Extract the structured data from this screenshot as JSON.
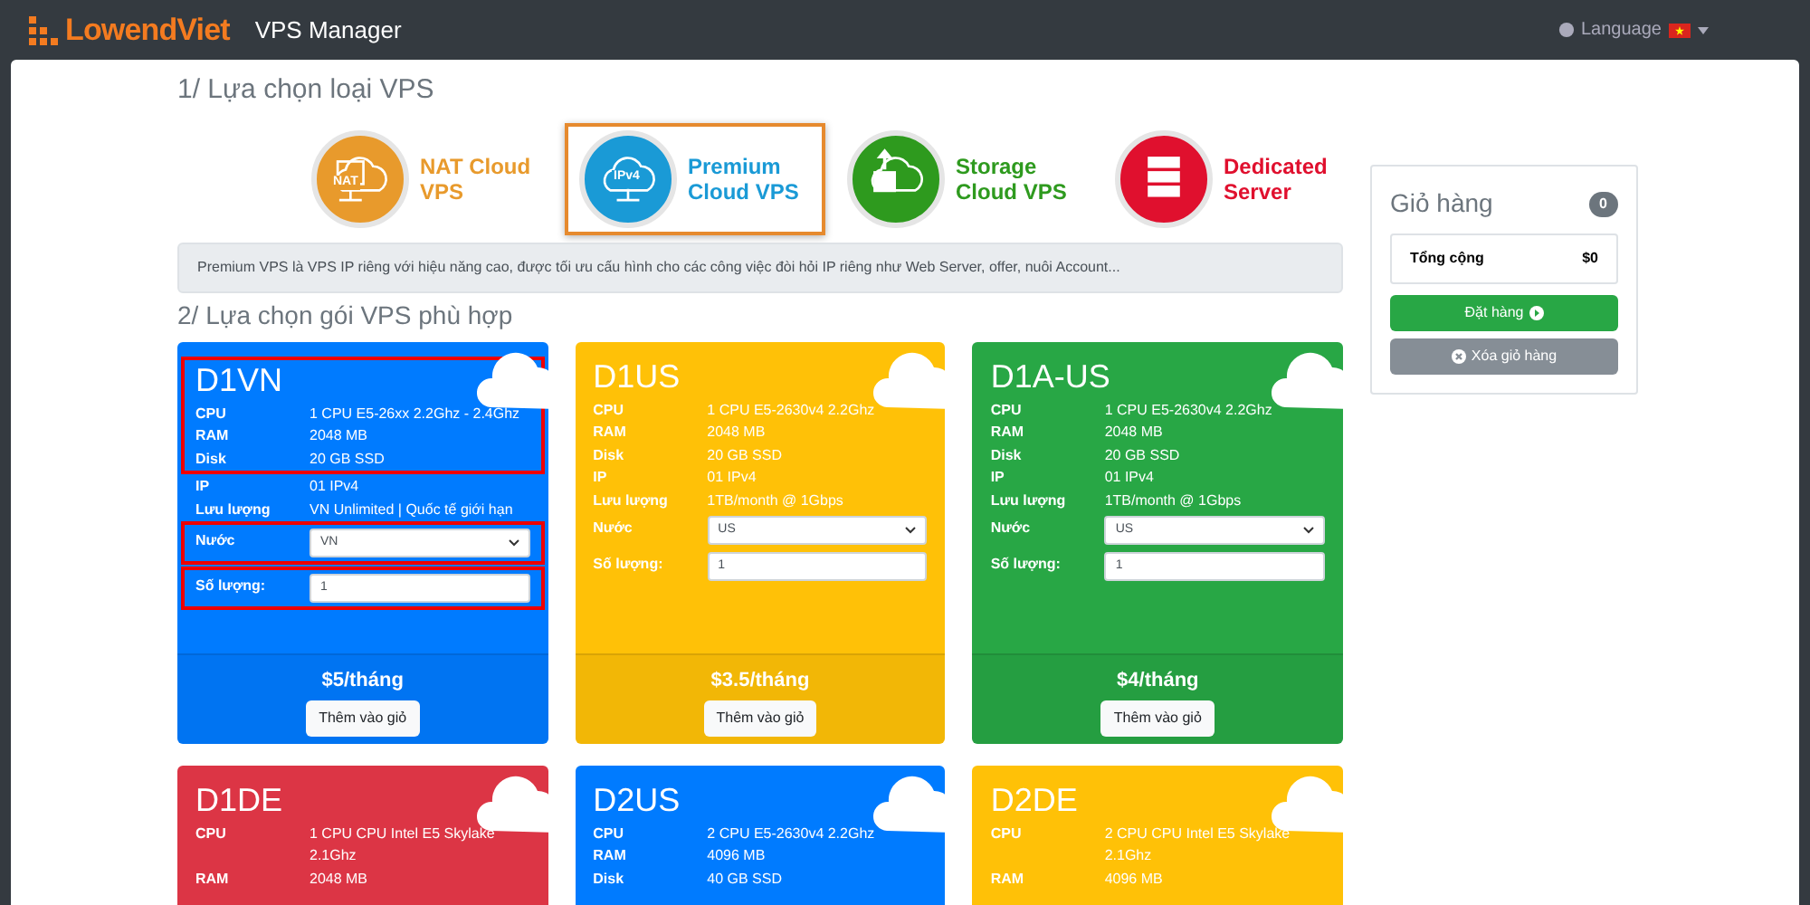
{
  "navbar": {
    "brand": "LowendViet",
    "title": "VPS Manager",
    "language": "Language"
  },
  "step1": {
    "heading": "1/ Lựa chọn loại VPS",
    "types": [
      {
        "kind": "nat",
        "label": "NAT Cloud VPS",
        "color": "#e89a2c",
        "selected": false,
        "icon_text": "NAT"
      },
      {
        "kind": "ipv4",
        "label": "Premium Cloud VPS",
        "color": "#1a9ad6",
        "selected": true,
        "icon_text": "IPv4"
      },
      {
        "kind": "storage",
        "label": "Storage Cloud VPS",
        "color": "#2e9a1e",
        "selected": false
      },
      {
        "kind": "server",
        "label": "Dedicated Server",
        "color": "#e0102e",
        "selected": false
      }
    ],
    "description": "Premium VPS là VPS IP riêng với hiệu năng cao, được tối ưu cấu hình cho các công việc đòi hỏi IP riêng như Web Server, offer, nuôi Account..."
  },
  "step2": {
    "heading": "2/ Lựa chọn gói VPS phù hợp",
    "cards": [
      {
        "color": "#007bff",
        "sections": [
          {
            "boxed": true,
            "items": [
              {
                "kind": "title",
                "text": "D1VN"
              },
              {
                "kind": "spec",
                "label": "CPU",
                "value": "1 CPU E5-26xx 2.2Ghz - 2.4Ghz"
              },
              {
                "kind": "spec",
                "label": "RAM",
                "value": "2048 MB"
              },
              {
                "kind": "spec",
                "label": "Disk",
                "value": "20 GB SSD"
              }
            ]
          },
          {
            "boxed": false,
            "items": [
              {
                "kind": "spec",
                "label": "IP",
                "value": "01 IPv4"
              },
              {
                "kind": "spec",
                "label": "Lưu lượng",
                "value": "VN Unlimited | Quốc tế giới hạn"
              }
            ]
          },
          {
            "boxed": true,
            "items": [
              {
                "kind": "select",
                "label": "Nước",
                "value": "VN"
              }
            ]
          },
          {
            "boxed": true,
            "items": [
              {
                "kind": "number",
                "label": "Số lượng:",
                "value": "1"
              }
            ]
          }
        ],
        "price": "$5/tháng",
        "button": "Thêm vào giỏ"
      },
      {
        "color": "#ffc107",
        "sections": [
          {
            "boxed": false,
            "items": [
              {
                "kind": "title",
                "text": "D1US"
              },
              {
                "kind": "spec",
                "label": "CPU",
                "value": "1 CPU E5-2630v4 2.2Ghz"
              },
              {
                "kind": "spec",
                "label": "RAM",
                "value": "2048 MB"
              },
              {
                "kind": "spec",
                "label": "Disk",
                "value": "20 GB SSD"
              },
              {
                "kind": "spec",
                "label": "IP",
                "value": "01 IPv4"
              },
              {
                "kind": "spec",
                "label": "Lưu lượng",
                "value": "1TB/month @ 1Gbps"
              },
              {
                "kind": "select",
                "label": "Nước",
                "value": "US"
              },
              {
                "kind": "number",
                "label": "Số lượng:",
                "value": "1"
              }
            ]
          }
        ],
        "price": "$3.5/tháng",
        "button": "Thêm vào giỏ"
      },
      {
        "color": "#28a745",
        "sections": [
          {
            "boxed": false,
            "items": [
              {
                "kind": "title",
                "text": "D1A-US"
              },
              {
                "kind": "spec",
                "label": "CPU",
                "value": "1 CPU E5-2630v4 2.2Ghz"
              },
              {
                "kind": "spec",
                "label": "RAM",
                "value": "2048 MB"
              },
              {
                "kind": "spec",
                "label": "Disk",
                "value": "20 GB SSD"
              },
              {
                "kind": "spec",
                "label": "IP",
                "value": "01 IPv4"
              },
              {
                "kind": "spec",
                "label": "Lưu lượng",
                "value": "1TB/month @ 1Gbps"
              },
              {
                "kind": "select",
                "label": "Nước",
                "value": "US"
              },
              {
                "kind": "number",
                "label": "Số lượng:",
                "value": "1"
              }
            ]
          }
        ],
        "price": "$4/tháng",
        "button": "Thêm vào giỏ"
      },
      {
        "color": "#dc3545",
        "sections": [
          {
            "boxed": false,
            "items": [
              {
                "kind": "title",
                "text": "D1DE"
              },
              {
                "kind": "spec",
                "label": "CPU",
                "value": "1 CPU CPU Intel E5 Skylake 2.1Ghz"
              },
              {
                "kind": "spec",
                "label": "RAM",
                "value": "2048 MB"
              }
            ]
          }
        ]
      },
      {
        "color": "#007bff",
        "sections": [
          {
            "boxed": false,
            "items": [
              {
                "kind": "title",
                "text": "D2US"
              },
              {
                "kind": "spec",
                "label": "CPU",
                "value": "2 CPU E5-2630v4 2.2Ghz"
              },
              {
                "kind": "spec",
                "label": "RAM",
                "value": "4096 MB"
              },
              {
                "kind": "spec",
                "label": "Disk",
                "value": "40 GB SSD"
              }
            ]
          }
        ]
      },
      {
        "color": "#ffc107",
        "sections": [
          {
            "boxed": false,
            "items": [
              {
                "kind": "title",
                "text": "D2DE"
              },
              {
                "kind": "spec",
                "label": "CPU",
                "value": "2 CPU CPU Intel E5 Skylake 2.1Ghz"
              },
              {
                "kind": "spec",
                "label": "RAM",
                "value": "4096 MB"
              }
            ]
          }
        ]
      }
    ]
  },
  "cart": {
    "title": "Giỏ hàng",
    "count": "0",
    "total_label": "Tổng cộng",
    "total": "$0",
    "order_button": "Đặt hàng",
    "clear_button": "Xóa giỏ hàng"
  }
}
